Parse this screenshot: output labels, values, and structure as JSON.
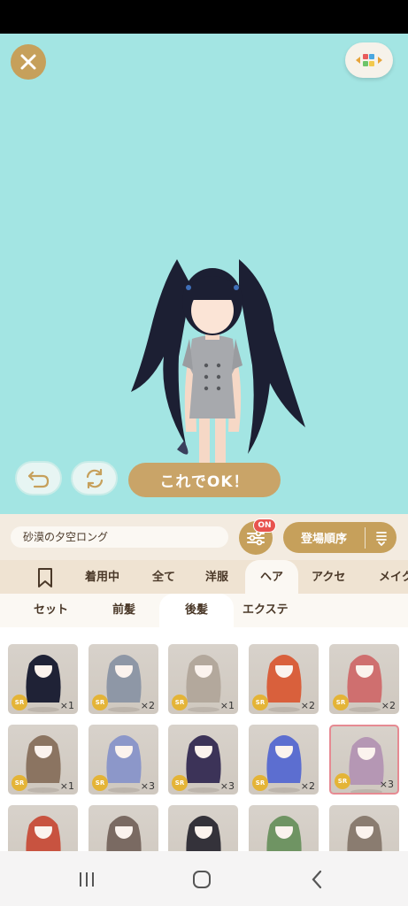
{
  "ok_label": "これでOK！",
  "item_name": "砂漠の夕空ロング",
  "filter_badge": "ON",
  "sort_label": "登場順序",
  "categories": [
    "着用中",
    "全て",
    "洋服",
    "ヘア",
    "アクセ",
    "メイク"
  ],
  "subcategories": [
    "セット",
    "前髪",
    "後髪",
    "エクステ"
  ],
  "rarity_label": "SR",
  "items": [
    {
      "count": "×1",
      "hair": "#1f2236"
    },
    {
      "count": "×2",
      "hair": "#8e97a6"
    },
    {
      "count": "×1",
      "hair": "#b3a89c"
    },
    {
      "count": "×2",
      "hair": "#d9603c"
    },
    {
      "count": "×2",
      "hair": "#cf6f6f"
    },
    {
      "count": "×1",
      "hair": "#8b7461"
    },
    {
      "count": "×3",
      "hair": "#8c97c9"
    },
    {
      "count": "×3",
      "hair": "#3c3358"
    },
    {
      "count": "×2",
      "hair": "#5c6ed0"
    },
    {
      "count": "×3",
      "hair": "#b597b4"
    },
    {
      "count": "",
      "hair": "#c85340"
    },
    {
      "count": "",
      "hair": "#7a6a62"
    },
    {
      "count": "",
      "hair": "#34323a"
    },
    {
      "count": "",
      "hair": "#6f9463"
    },
    {
      "count": "",
      "hair": "#8a7c70"
    }
  ]
}
